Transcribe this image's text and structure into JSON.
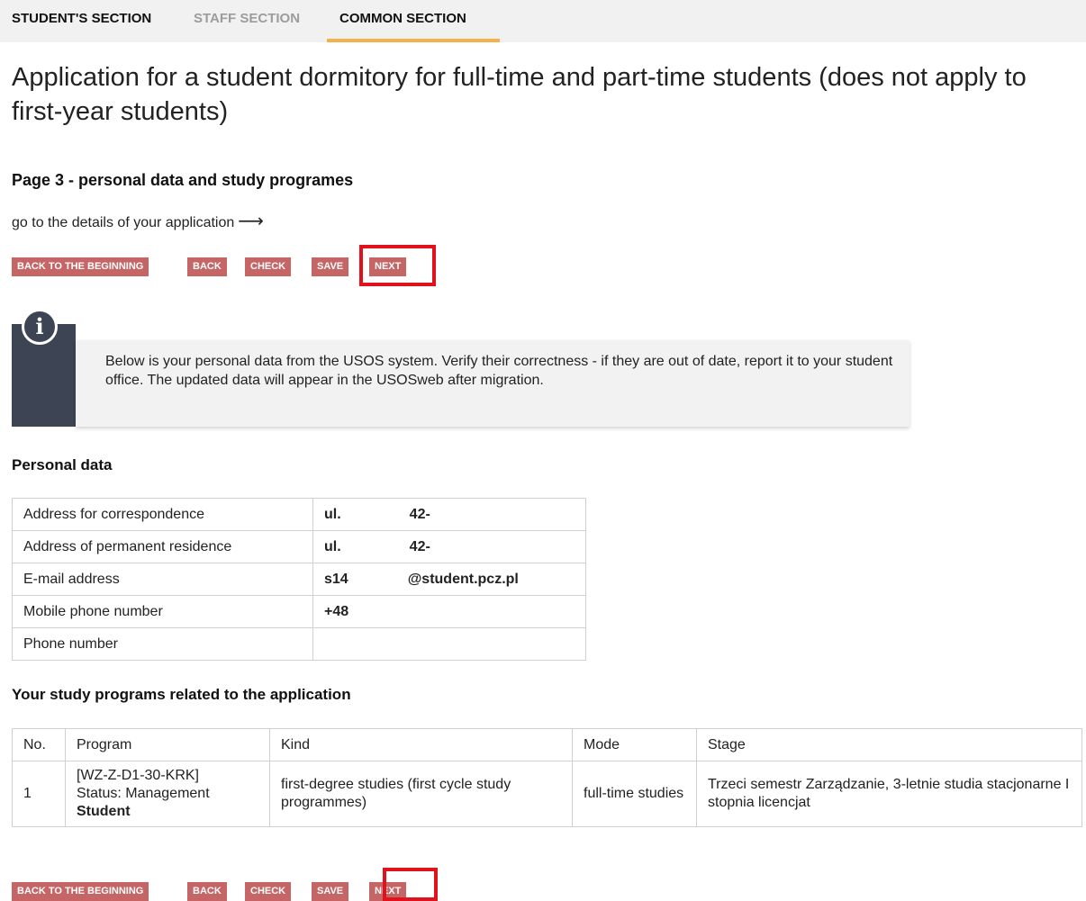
{
  "nav": {
    "tabs": [
      {
        "label": "STUDENT'S SECTION",
        "state": "normal"
      },
      {
        "label": "STAFF SECTION",
        "state": "muted"
      },
      {
        "label": "COMMON SECTION",
        "state": "active"
      }
    ]
  },
  "page": {
    "title": "Application for a student dormitory for full-time and part-time students (does not apply to first-year students)",
    "subtitle": "Page 3 - personal data and study programes",
    "details_link": "go to the details of your application",
    "details_arrow": "⟶"
  },
  "buttons": {
    "back_to_beginning": "BACK TO THE BEGINNING",
    "back": "BACK",
    "check": "CHECK",
    "save": "SAVE",
    "next": "NEXT"
  },
  "info": {
    "icon": "info-icon",
    "text": "Below is your personal data from the USOS system. Verify their correctness - if they are out of date, report it to your student office. The updated data will appear in the USOSweb after migration."
  },
  "personal": {
    "heading": "Personal data",
    "rows": [
      {
        "label": "Address for correspondence",
        "value_a": "ul.",
        "value_b": "42-"
      },
      {
        "label": "Address of permanent residence",
        "value_a": "ul.",
        "value_b": "42-"
      },
      {
        "label": "E-mail address",
        "value_a": "s14",
        "value_b": "@student.pcz.pl"
      },
      {
        "label": "Mobile phone number",
        "value_a": "+48",
        "value_b": ""
      },
      {
        "label": "Phone number",
        "value_a": "",
        "value_b": ""
      }
    ]
  },
  "programs": {
    "heading": "Your study programs related to the application",
    "columns": [
      "No.",
      "Program",
      "Kind",
      "Mode",
      "Stage"
    ],
    "rows": [
      {
        "no": "1",
        "program_code": "[WZ-Z-D1-30-KRK]",
        "program_status": "Status: Management",
        "program_role": "Student",
        "kind": "first-degree studies (first cycle study programmes)",
        "mode": "full-time studies",
        "stage": "Trzeci semestr Zarządzanie, 3-letnie studia stacjonarne I stopnia licencjat"
      }
    ]
  },
  "colors": {
    "button": "#c56565",
    "highlight": "#e2121c",
    "active_tab": "#f6b14b",
    "info_bar": "#3d4454"
  }
}
